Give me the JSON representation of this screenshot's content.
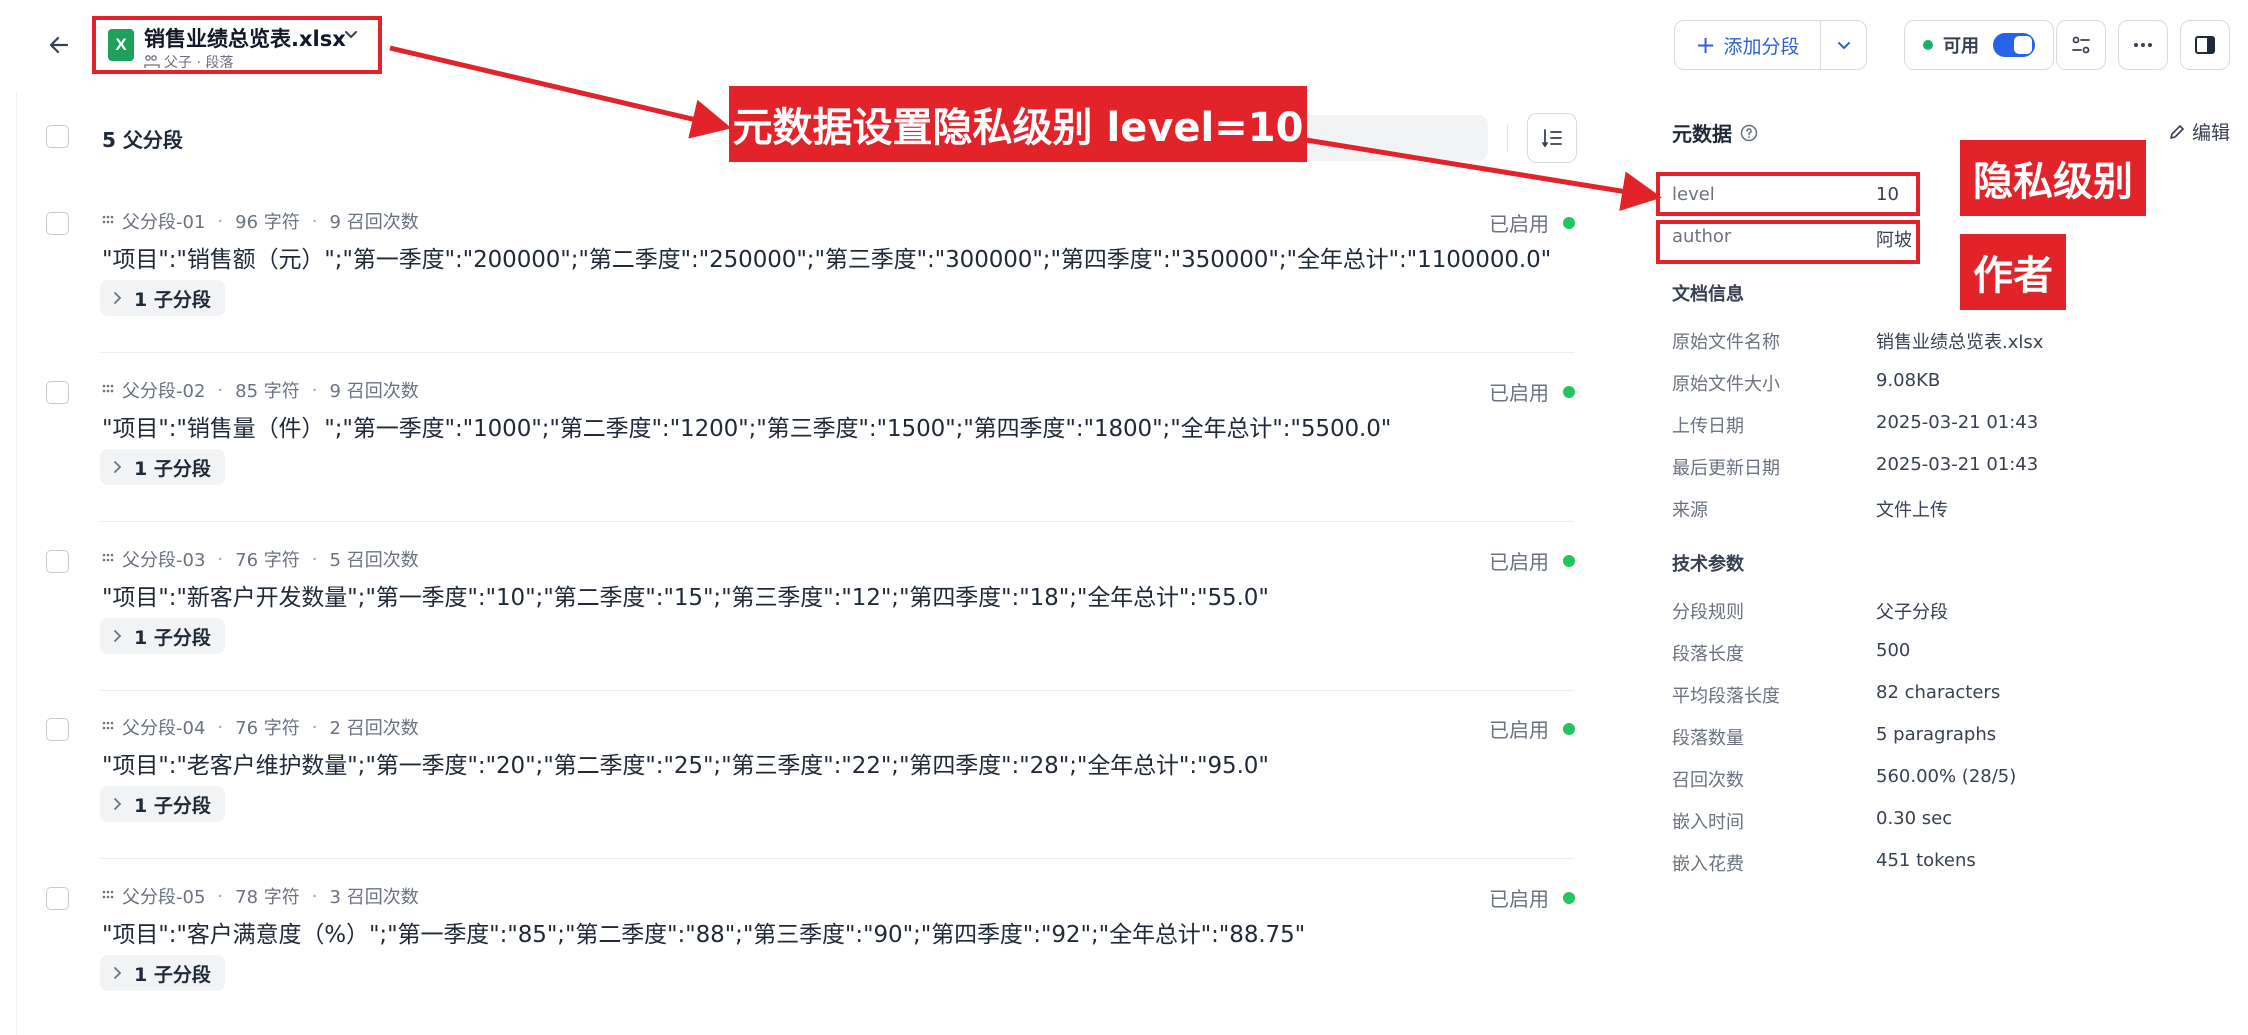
{
  "header": {
    "file_name": "销售业绩总览表.xlsx",
    "file_icon_letter": "X",
    "file_subtitle": "父子 · 段落",
    "add_segment_label": "添加分段",
    "status_label": "可用"
  },
  "list": {
    "title": "5 父分段",
    "segments": [
      {
        "id": "父分段-01",
        "chars": "96 字符",
        "recalls": "9 召回次数",
        "status": "已启用",
        "content": "\"项目\":\"销售额（元）\";\"第一季度\":\"200000\";\"第二季度\":\"250000\";\"第三季度\":\"300000\";\"第四季度\":\"350000\";\"全年总计\":\"1100000.0\"",
        "child_label": "1 子分段"
      },
      {
        "id": "父分段-02",
        "chars": "85 字符",
        "recalls": "9 召回次数",
        "status": "已启用",
        "content": "\"项目\":\"销售量（件）\";\"第一季度\":\"1000\";\"第二季度\":\"1200\";\"第三季度\":\"1500\";\"第四季度\":\"1800\";\"全年总计\":\"5500.0\"",
        "child_label": "1 子分段"
      },
      {
        "id": "父分段-03",
        "chars": "76 字符",
        "recalls": "5 召回次数",
        "status": "已启用",
        "content": "\"项目\":\"新客户开发数量\";\"第一季度\":\"10\";\"第二季度\":\"15\";\"第三季度\":\"12\";\"第四季度\":\"18\";\"全年总计\":\"55.0\"",
        "child_label": "1 子分段"
      },
      {
        "id": "父分段-04",
        "chars": "76 字符",
        "recalls": "2 召回次数",
        "status": "已启用",
        "content": "\"项目\":\"老客户维护数量\";\"第一季度\":\"20\";\"第二季度\":\"25\";\"第三季度\":\"22\";\"第四季度\":\"28\";\"全年总计\":\"95.0\"",
        "child_label": "1 子分段"
      },
      {
        "id": "父分段-05",
        "chars": "78 字符",
        "recalls": "3 召回次数",
        "status": "已启用",
        "content": "\"项目\":\"客户满意度（%）\";\"第一季度\":\"85\";\"第二季度\":\"88\";\"第三季度\":\"90\";\"第四季度\":\"92\";\"全年总计\":\"88.75\"",
        "child_label": "1 子分段"
      }
    ]
  },
  "panel": {
    "metadata_title": "元数据",
    "edit_label": "编辑",
    "metadata": [
      {
        "key": "level",
        "value": "10"
      },
      {
        "key": "author",
        "value": "阿坡"
      }
    ],
    "doc_info_title": "文档信息",
    "doc_info": [
      {
        "key": "原始文件名称",
        "value": "销售业绩总览表.xlsx"
      },
      {
        "key": "原始文件大小",
        "value": "9.08KB"
      },
      {
        "key": "上传日期",
        "value": "2025-03-21 01:43"
      },
      {
        "key": "最后更新日期",
        "value": "2025-03-21 01:43"
      },
      {
        "key": "来源",
        "value": "文件上传"
      }
    ],
    "tech_title": "技术参数",
    "tech": [
      {
        "key": "分段规则",
        "value": "父子分段"
      },
      {
        "key": "段落长度",
        "value": "500"
      },
      {
        "key": "平均段落长度",
        "value": "82 characters"
      },
      {
        "key": "段落数量",
        "value": "5 paragraphs"
      },
      {
        "key": "召回次数",
        "value": "560.00% (28/5)"
      },
      {
        "key": "嵌入时间",
        "value": "0.30 sec"
      },
      {
        "key": "嵌入花费",
        "value": "451 tokens"
      }
    ]
  },
  "annotations": {
    "main_label": "元数据设置隐私级别 level=10",
    "privacy_label": "隐私级别",
    "author_label": "作者",
    "accent_color": "#e3232a"
  }
}
